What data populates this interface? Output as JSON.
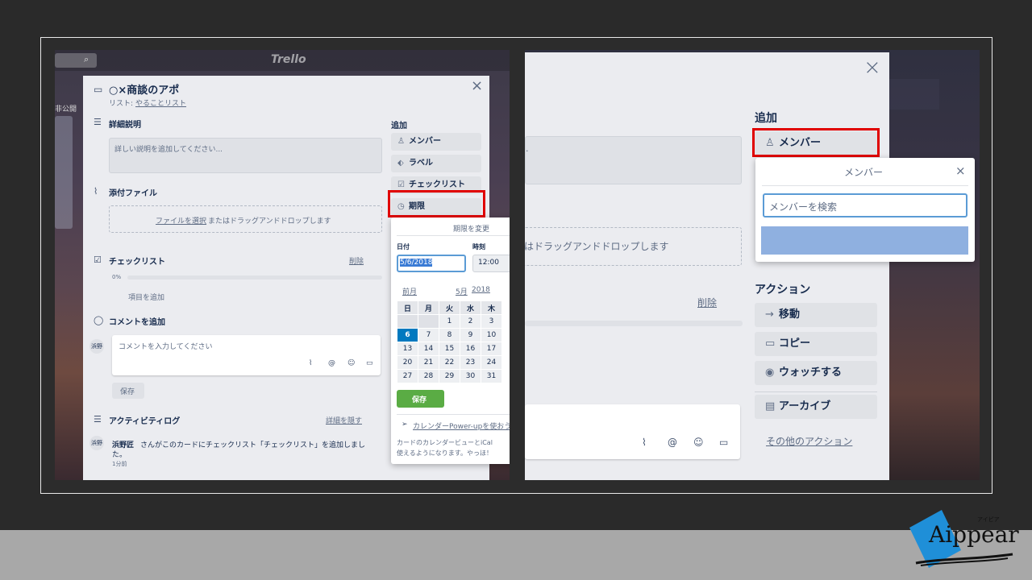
{
  "left": {
    "search_icon": "⌕",
    "logo_text": "Trello",
    "side_text": "非公開",
    "card_title": "○×商談のアポ",
    "list_prefix": "リスト: ",
    "list_name": "やることリスト",
    "close": "×",
    "desc_heading": "詳細説明",
    "desc_placeholder": "詳しい説明を追加してください...",
    "attach_heading": "添付ファイル",
    "attach_select": "ファイルを選択",
    "attach_rest": "またはドラッグアンドドロップします",
    "checklist_heading": "チェックリスト",
    "checklist_delete": "削除",
    "checklist_percent": "0%",
    "checklist_add_item": "項目を追加",
    "comment_heading": "コメントを追加",
    "comment_avatar": "浜野",
    "comment_placeholder": "コメントを入力してください",
    "comment_save": "保存",
    "activity_heading": "アクティビティログ",
    "activity_hide": "詳細を隠す",
    "activity_user": "浜野匠",
    "activity_text_1": "さんがこのカードにチェックリスト「チェックリスト」を追加しまし",
    "activity_text_2": "た。",
    "activity_time": "1分前",
    "add_heading": "追加",
    "add_buttons": [
      "メンバー",
      "ラベル",
      "チェックリスト",
      "期限"
    ],
    "due_popover": {
      "title": "期限を変更",
      "date_label": "日付",
      "time_label": "時刻",
      "date_value": "5/6/2018",
      "time_value": "12:00",
      "prev": "前月",
      "month": "5月",
      "year": "2018",
      "weekdays": [
        "日",
        "月",
        "火",
        "水",
        "木"
      ],
      "rows": [
        [
          "",
          "",
          "1",
          "2",
          "3"
        ],
        [
          "6",
          "7",
          "8",
          "9",
          "10"
        ],
        [
          "13",
          "14",
          "15",
          "16",
          "17"
        ],
        [
          "20",
          "21",
          "22",
          "23",
          "24"
        ],
        [
          "27",
          "28",
          "29",
          "30",
          "31"
        ]
      ],
      "selected_day": "6",
      "save": "保存",
      "powerup_link": "カレンダーPower-upを使おう",
      "powerup_desc_1": "カードのカレンダービューとiCal",
      "powerup_desc_2": "使えるようになります。やっほ！"
    }
  },
  "right": {
    "close": "×",
    "add_heading": "追加",
    "member_button": "メンバー",
    "member_popover_title": "メンバー",
    "member_popover_close": "×",
    "member_search_placeholder": "メンバーを検索",
    "partial_dot": ".",
    "attach_rest": "はドラッグアンドドロップします",
    "delete": "削除",
    "action_heading": "アクション",
    "actions": [
      "移動",
      "コピー",
      "ウォッチする",
      "アーカイブ"
    ],
    "more_actions": "その他のアクション"
  },
  "brand": {
    "logo_text": "Aippear",
    "logo_ruby": "アイピア",
    "logo_color": "#1f8fd8"
  }
}
